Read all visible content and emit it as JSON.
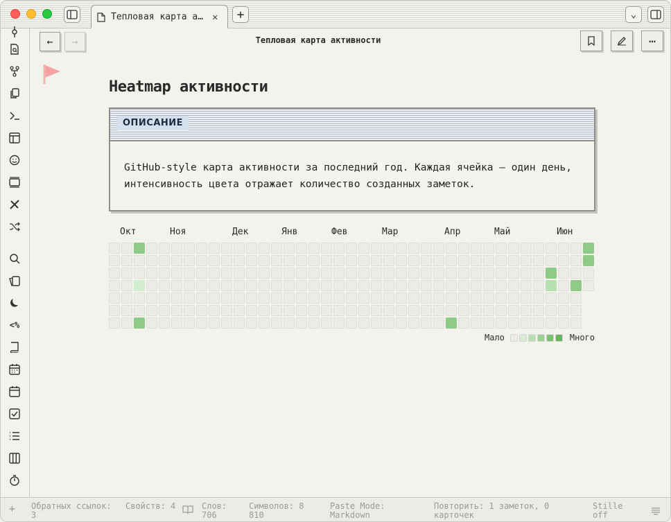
{
  "window": {
    "tab_title": "Тепловая карта а…",
    "close_glyph": "✕",
    "new_tab_glyph": "+",
    "chevron_glyph": "⌄"
  },
  "toolbar": {
    "back_glyph": "←",
    "forward_glyph": "→",
    "doc_title": "Тепловая карта активности",
    "more_glyph": "⋯"
  },
  "page": {
    "title": "Heatmap активности"
  },
  "callout": {
    "label": "ОПИСАНИЕ",
    "text": "GitHub-style карта активности за последний год. Каждая ячейка — один день, интенсивность цвета отражает количество созданных заметок."
  },
  "heatmap": {
    "months": [
      "Окт",
      "Ноя",
      "Дек",
      "Янв",
      "Фев",
      "Мар",
      "Апр",
      "Май",
      "Июн"
    ],
    "legend_less": "Мало",
    "legend_more": "Много",
    "legend_colors": [
      "#ebebe7",
      "#d7ecd3",
      "#b9deb4",
      "#9bd194",
      "#7cc275",
      "#68b361"
    ],
    "active_cells": [
      {
        "week": 2,
        "day": 0,
        "level": 3
      },
      {
        "week": 2,
        "day": 3,
        "level": 1
      },
      {
        "week": 2,
        "day": 6,
        "level": 3
      },
      {
        "week": 27,
        "day": 6,
        "level": 3
      },
      {
        "week": 35,
        "day": 2,
        "level": 3
      },
      {
        "week": 35,
        "day": 3,
        "level": 2
      },
      {
        "week": 37,
        "day": 3,
        "level": 3
      },
      {
        "week": 38,
        "day": 0,
        "level": 3
      },
      {
        "week": 38,
        "day": 1,
        "level": 3
      }
    ],
    "level_colors": [
      "#ebebe7",
      "#d2ecce",
      "#b6e0b0",
      "#8fcb87"
    ]
  },
  "status": {
    "backlinks": "Обратных ссылок: 3",
    "properties": "Свойств: 4",
    "words": "Слов: 706",
    "chars": "Символов: 8 810",
    "paste_mode": "Paste Mode: Markdown",
    "repeat": "Повторить: 1 заметок, 0 карточек",
    "stille": "Stille off"
  }
}
